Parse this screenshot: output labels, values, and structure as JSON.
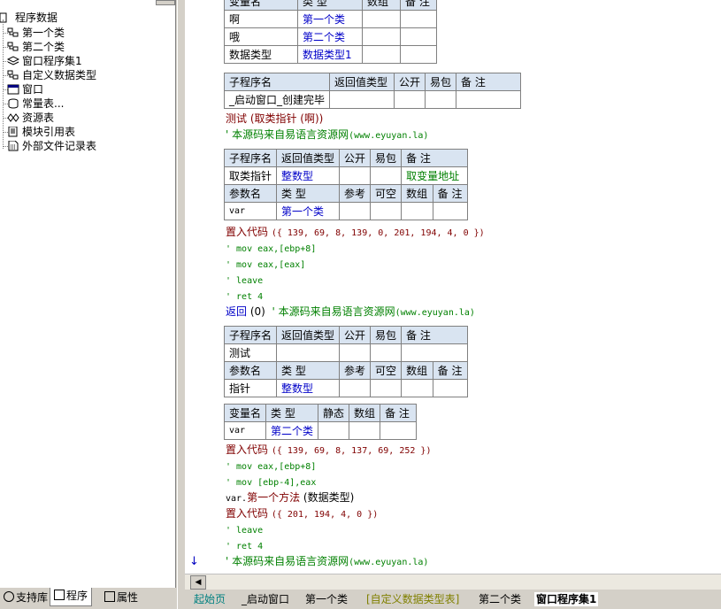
{
  "tree": {
    "root": "程序数据",
    "items": [
      {
        "label": "第一个类",
        "icon": "class-icon"
      },
      {
        "label": "第二个类",
        "icon": "class-icon"
      },
      {
        "label": "窗口程序集1",
        "icon": "assembly-icon"
      },
      {
        "label": "自定义数据类型",
        "icon": "class-icon"
      },
      {
        "label": "窗口",
        "icon": "window-icon"
      },
      {
        "label": "常量表...",
        "icon": "constant-icon"
      },
      {
        "label": "资源表",
        "icon": "resource-icon"
      },
      {
        "label": "模块引用表",
        "icon": "module-icon"
      },
      {
        "label": "外部文件记录表",
        "icon": "file-icon"
      }
    ]
  },
  "left_tabs": [
    "支持库",
    "程序",
    "属性"
  ],
  "top_table": {
    "header": [
      "变量名",
      "类 型",
      "数组",
      "备 注"
    ],
    "rows": [
      [
        "啊",
        "第一个类"
      ],
      [
        "哦",
        "第二个类"
      ],
      [
        "数据类型",
        "数据类型1"
      ]
    ]
  },
  "sub1": {
    "header": [
      "子程序名",
      "返回值类型",
      "公开",
      "易包",
      "备 注"
    ],
    "name": "_启动窗口_创建完毕"
  },
  "line_call": "测试 (取类指针 (啊))",
  "comment_src": "' 本源码来自易语言资源网",
  "comment_url": "(www.eyuyan.la)",
  "sub2": {
    "header": [
      "子程序名",
      "返回值类型",
      "公开",
      "易包",
      "备 注"
    ],
    "name": "取类指针",
    "ret": "整数型",
    "note": "取变量地址",
    "param_header": [
      "参数名",
      "类 型",
      "参考",
      "可空",
      "数组",
      "备 注"
    ],
    "param_name": "var",
    "param_type": "第一个类"
  },
  "code1": {
    "kw": "置入代码",
    "args": "({ 139, 69, 8, 139, 0, 201, 194, 4, 0 })",
    "comments": [
      "' mov eax,[ebp+8]",
      "' mov eax,[eax]",
      "' leave",
      "' ret 4"
    ]
  },
  "return_line": {
    "kw": "返回",
    "arg": "(0)"
  },
  "sub3": {
    "header": [
      "子程序名",
      "返回值类型",
      "公开",
      "易包",
      "备 注"
    ],
    "name": "测试",
    "param_header": [
      "参数名",
      "类 型",
      "参考",
      "可空",
      "数组",
      "备 注"
    ],
    "param_name": "指针",
    "param_type": "整数型"
  },
  "var_table": {
    "header": [
      "变量名",
      "类 型",
      "静态",
      "数组",
      "备 注"
    ],
    "name": "var",
    "type": "第二个类"
  },
  "code2": {
    "kw": "置入代码",
    "args": "({ 139, 69, 8, 137, 69, 252 })",
    "comments": [
      "' mov eax,[ebp+8]",
      "' mov [ebp-4],eax"
    ]
  },
  "method_line": {
    "obj": "var.",
    "method": "第一个方法",
    "arg": " (数据类型)"
  },
  "code3": {
    "kw": "置入代码",
    "args": "({ 201, 194, 4, 0 })",
    "comments": [
      "' leave",
      "' ret 4"
    ]
  },
  "file_tabs": [
    "起始页",
    "_启动窗口",
    "第一个类",
    "[自定义数据类型表]",
    "第二个类",
    "窗口程序集1"
  ]
}
